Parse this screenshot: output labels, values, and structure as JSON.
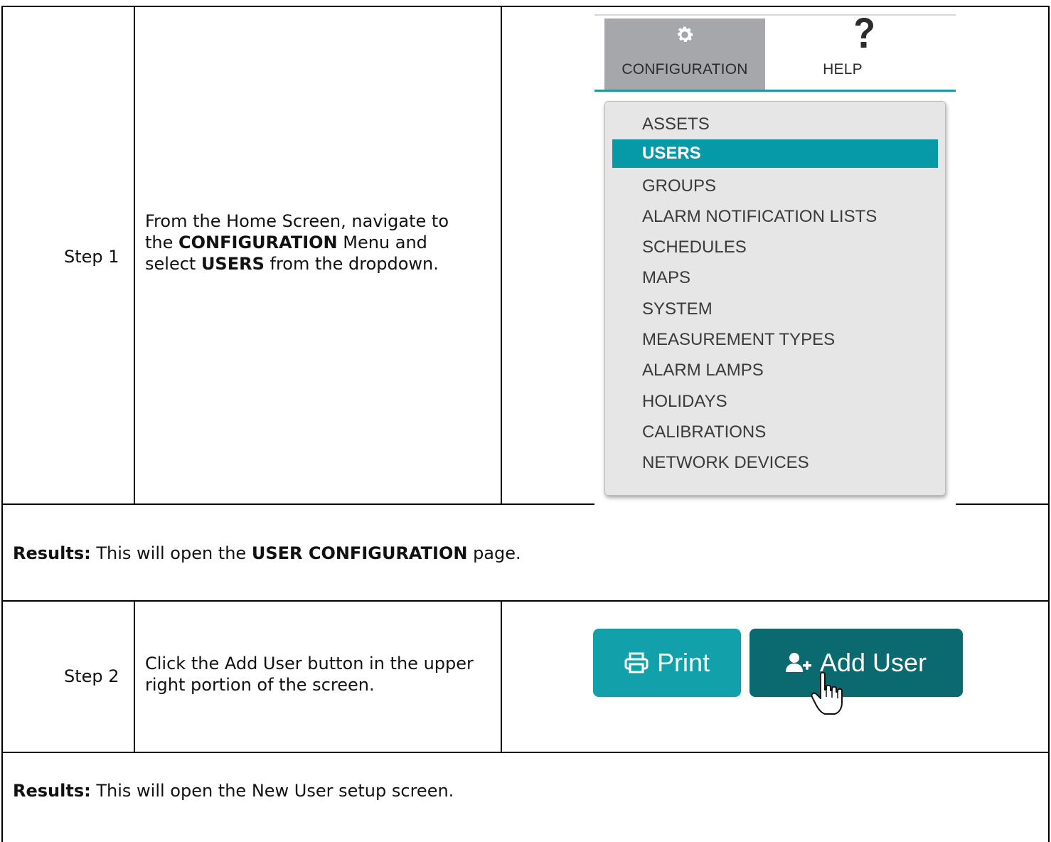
{
  "steps": [
    {
      "label": "Step 1",
      "text": {
        "part1": "From the Home Screen, navigate to the ",
        "bold1": "CONFIGURATION",
        "part2": " Menu and select ",
        "bold2": "USERS",
        "part3": " from the dropdown."
      },
      "screenshot": {
        "tabs": [
          {
            "label": "CONFIGURATION",
            "icon": "gear-icon",
            "active": true
          },
          {
            "label": "HELP",
            "icon": "question-mark-icon",
            "active": false
          }
        ],
        "menu_items": [
          "ASSETS",
          "USERS",
          "GROUPS",
          "ALARM NOTIFICATION LISTS",
          "SCHEDULES",
          "MAPS",
          "SYSTEM",
          "MEASUREMENT TYPES",
          "ALARM LAMPS",
          "HOLIDAYS",
          "CALIBRATIONS",
          "NETWORK DEVICES"
        ],
        "selected_item": "USERS"
      },
      "result": {
        "prefix": "Results:",
        "text1": " This will open the ",
        "bold": "USER CONFIGURATION",
        "text2": " page."
      }
    },
    {
      "label": "Step 2",
      "text": {
        "part1": "Click the Add User button in the upper right portion of the screen."
      },
      "screenshot": {
        "buttons": [
          {
            "label": "Print",
            "icon": "printer-icon"
          },
          {
            "label": "Add User",
            "icon": "add-user-icon"
          }
        ],
        "cursor": "pointer-hand-icon"
      },
      "result": {
        "prefix": "Results:",
        "text1": " This will open the New User setup screen."
      }
    }
  ],
  "colors": {
    "tab_active_bg": "#a6a7ab",
    "accent_teal": "#1e97a3",
    "selected_item_bg": "#0699a8",
    "print_button_bg": "#12a0aa",
    "add_user_button_bg": "#0b6a70",
    "dropdown_bg": "#e6e6e7"
  }
}
